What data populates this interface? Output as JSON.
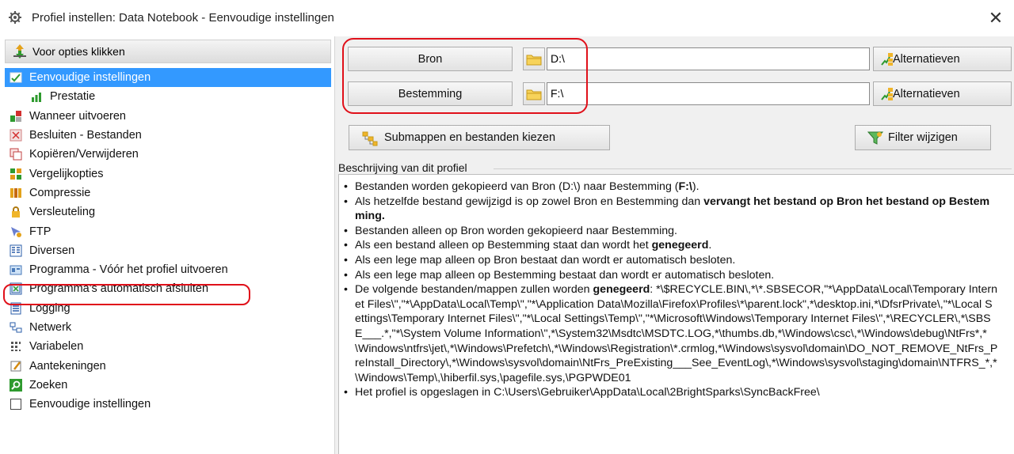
{
  "window": {
    "title": "Profiel instellen: Data Notebook - Eenvoudige instellingen",
    "close_label": "✕"
  },
  "sidebar": {
    "header_label": "Voor opties klikken",
    "items": [
      {
        "label": "Eenvoudige instellingen",
        "icon": "simple-settings-icon",
        "selected": true
      },
      {
        "label": "Prestatie",
        "icon": "bar-chart-icon",
        "sub": true
      },
      {
        "label": "Wanneer uitvoeren",
        "icon": "schedule-icon"
      },
      {
        "label": "Besluiten - Bestanden",
        "icon": "decisions-icon"
      },
      {
        "label": "Kopiëren/Verwijderen",
        "icon": "copy-delete-icon"
      },
      {
        "label": "Vergelijkopties",
        "icon": "compare-icon"
      },
      {
        "label": "Compressie",
        "icon": "compression-icon"
      },
      {
        "label": "Versleuteling",
        "icon": "lock-icon"
      },
      {
        "label": "FTP",
        "icon": "ftp-icon"
      },
      {
        "label": "Diversen",
        "icon": "misc-icon"
      },
      {
        "label": "Programma - Vóór het profiel uitvoeren",
        "icon": "program-icon"
      },
      {
        "label": "Programma's automatisch afsluiten",
        "icon": "program-close-icon"
      },
      {
        "label": "Logging",
        "icon": "logging-icon"
      },
      {
        "label": "Netwerk",
        "icon": "network-icon"
      },
      {
        "label": "Variabelen",
        "icon": "variables-icon"
      },
      {
        "label": "Aantekeningen",
        "icon": "notes-icon"
      },
      {
        "label": "Zoeken",
        "icon": "search-icon"
      },
      {
        "label": "Eenvoudige instellingen",
        "icon": "checkbox-icon"
      }
    ]
  },
  "paths": {
    "source_label": "Bron",
    "source_value": "D:\\",
    "destination_label": "Bestemming",
    "destination_value": "F:\\",
    "alternatives_label": "Alternatieven"
  },
  "actions": {
    "subfolders_label": "Submappen en bestanden kiezen",
    "filter_label": "Filter wijzigen"
  },
  "description": {
    "label": "Beschrijving van dit profiel",
    "items": [
      {
        "parts": [
          {
            "t": "Bestanden worden gekopieerd van Bron (D:\\) naar Bestemming ("
          },
          {
            "t": "F:\\",
            "b": true
          },
          {
            "t": ")."
          }
        ]
      },
      {
        "parts": [
          {
            "t": "Als hetzelfde bestand gewijzigd is op zowel Bron en Bestemming dan "
          },
          {
            "t": "vervangt het bestand op Bron het bestand op Bestemming.",
            "b": true
          }
        ]
      },
      {
        "parts": [
          {
            "t": "Bestanden alleen op Bron worden gekopieerd naar Bestemming."
          }
        ]
      },
      {
        "parts": [
          {
            "t": "Als een bestand alleen op Bestemming staat dan wordt het "
          },
          {
            "t": "genegeerd",
            "b": true
          },
          {
            "t": "."
          }
        ]
      },
      {
        "parts": [
          {
            "t": "Als een lege map alleen op Bron bestaat dan wordt er automatisch besloten."
          }
        ]
      },
      {
        "parts": [
          {
            "t": "Als een lege map alleen op Bestemming bestaat dan wordt er automatisch besloten."
          }
        ]
      },
      {
        "parts": [
          {
            "t": "De volgende bestanden/mappen zullen worden "
          },
          {
            "t": "genegeerd",
            "b": true
          },
          {
            "t": ": *\\$RECYCLE.BIN\\,*\\*.SBSECOR,\"*\\AppData\\Local\\Temporary Internet Files\\\",\"*\\AppData\\Local\\Temp\\\",\"*\\Application Data\\Mozilla\\Firefox\\Profiles\\*\\parent.lock\",*\\desktop.ini,*\\DfsrPrivate\\,\"*\\Local Settings\\Temporary Internet Files\\\",\"*\\Local Settings\\Temp\\\",\"*\\Microsoft\\Windows\\Temporary Internet Files\\\",*\\RECYCLER\\,*\\SBSE___.*,\"*\\System Volume Information\\\",*\\System32\\Msdtc\\MSDTC.LOG,*\\thumbs.db,*\\Windows\\csc\\,*\\Windows\\debug\\NtFrs*,*\\Windows\\ntfrs\\jet\\,*\\Windows\\Prefetch\\,*\\Windows\\Registration\\*.crmlog,*\\Windows\\sysvol\\domain\\DO_NOT_REMOVE_NtFrs_PreInstall_Directory\\,*\\Windows\\sysvol\\domain\\NtFrs_PreExisting___See_EventLog\\,*\\Windows\\sysvol\\staging\\domain\\NTFRS_*,*\\Windows\\Temp\\,\\hiberfil.sys,\\pagefile.sys,\\PGPWDE01"
          }
        ]
      },
      {
        "parts": [
          {
            "t": "Het profiel is opgeslagen in C:\\Users\\Gebruiker\\AppData\\Local\\2BrightSparks\\SyncBackFree\\"
          }
        ]
      }
    ]
  },
  "colors": {
    "selection": "#3399ff",
    "highlight": "#e0101a",
    "panel_bg": "#f0f0f0"
  }
}
